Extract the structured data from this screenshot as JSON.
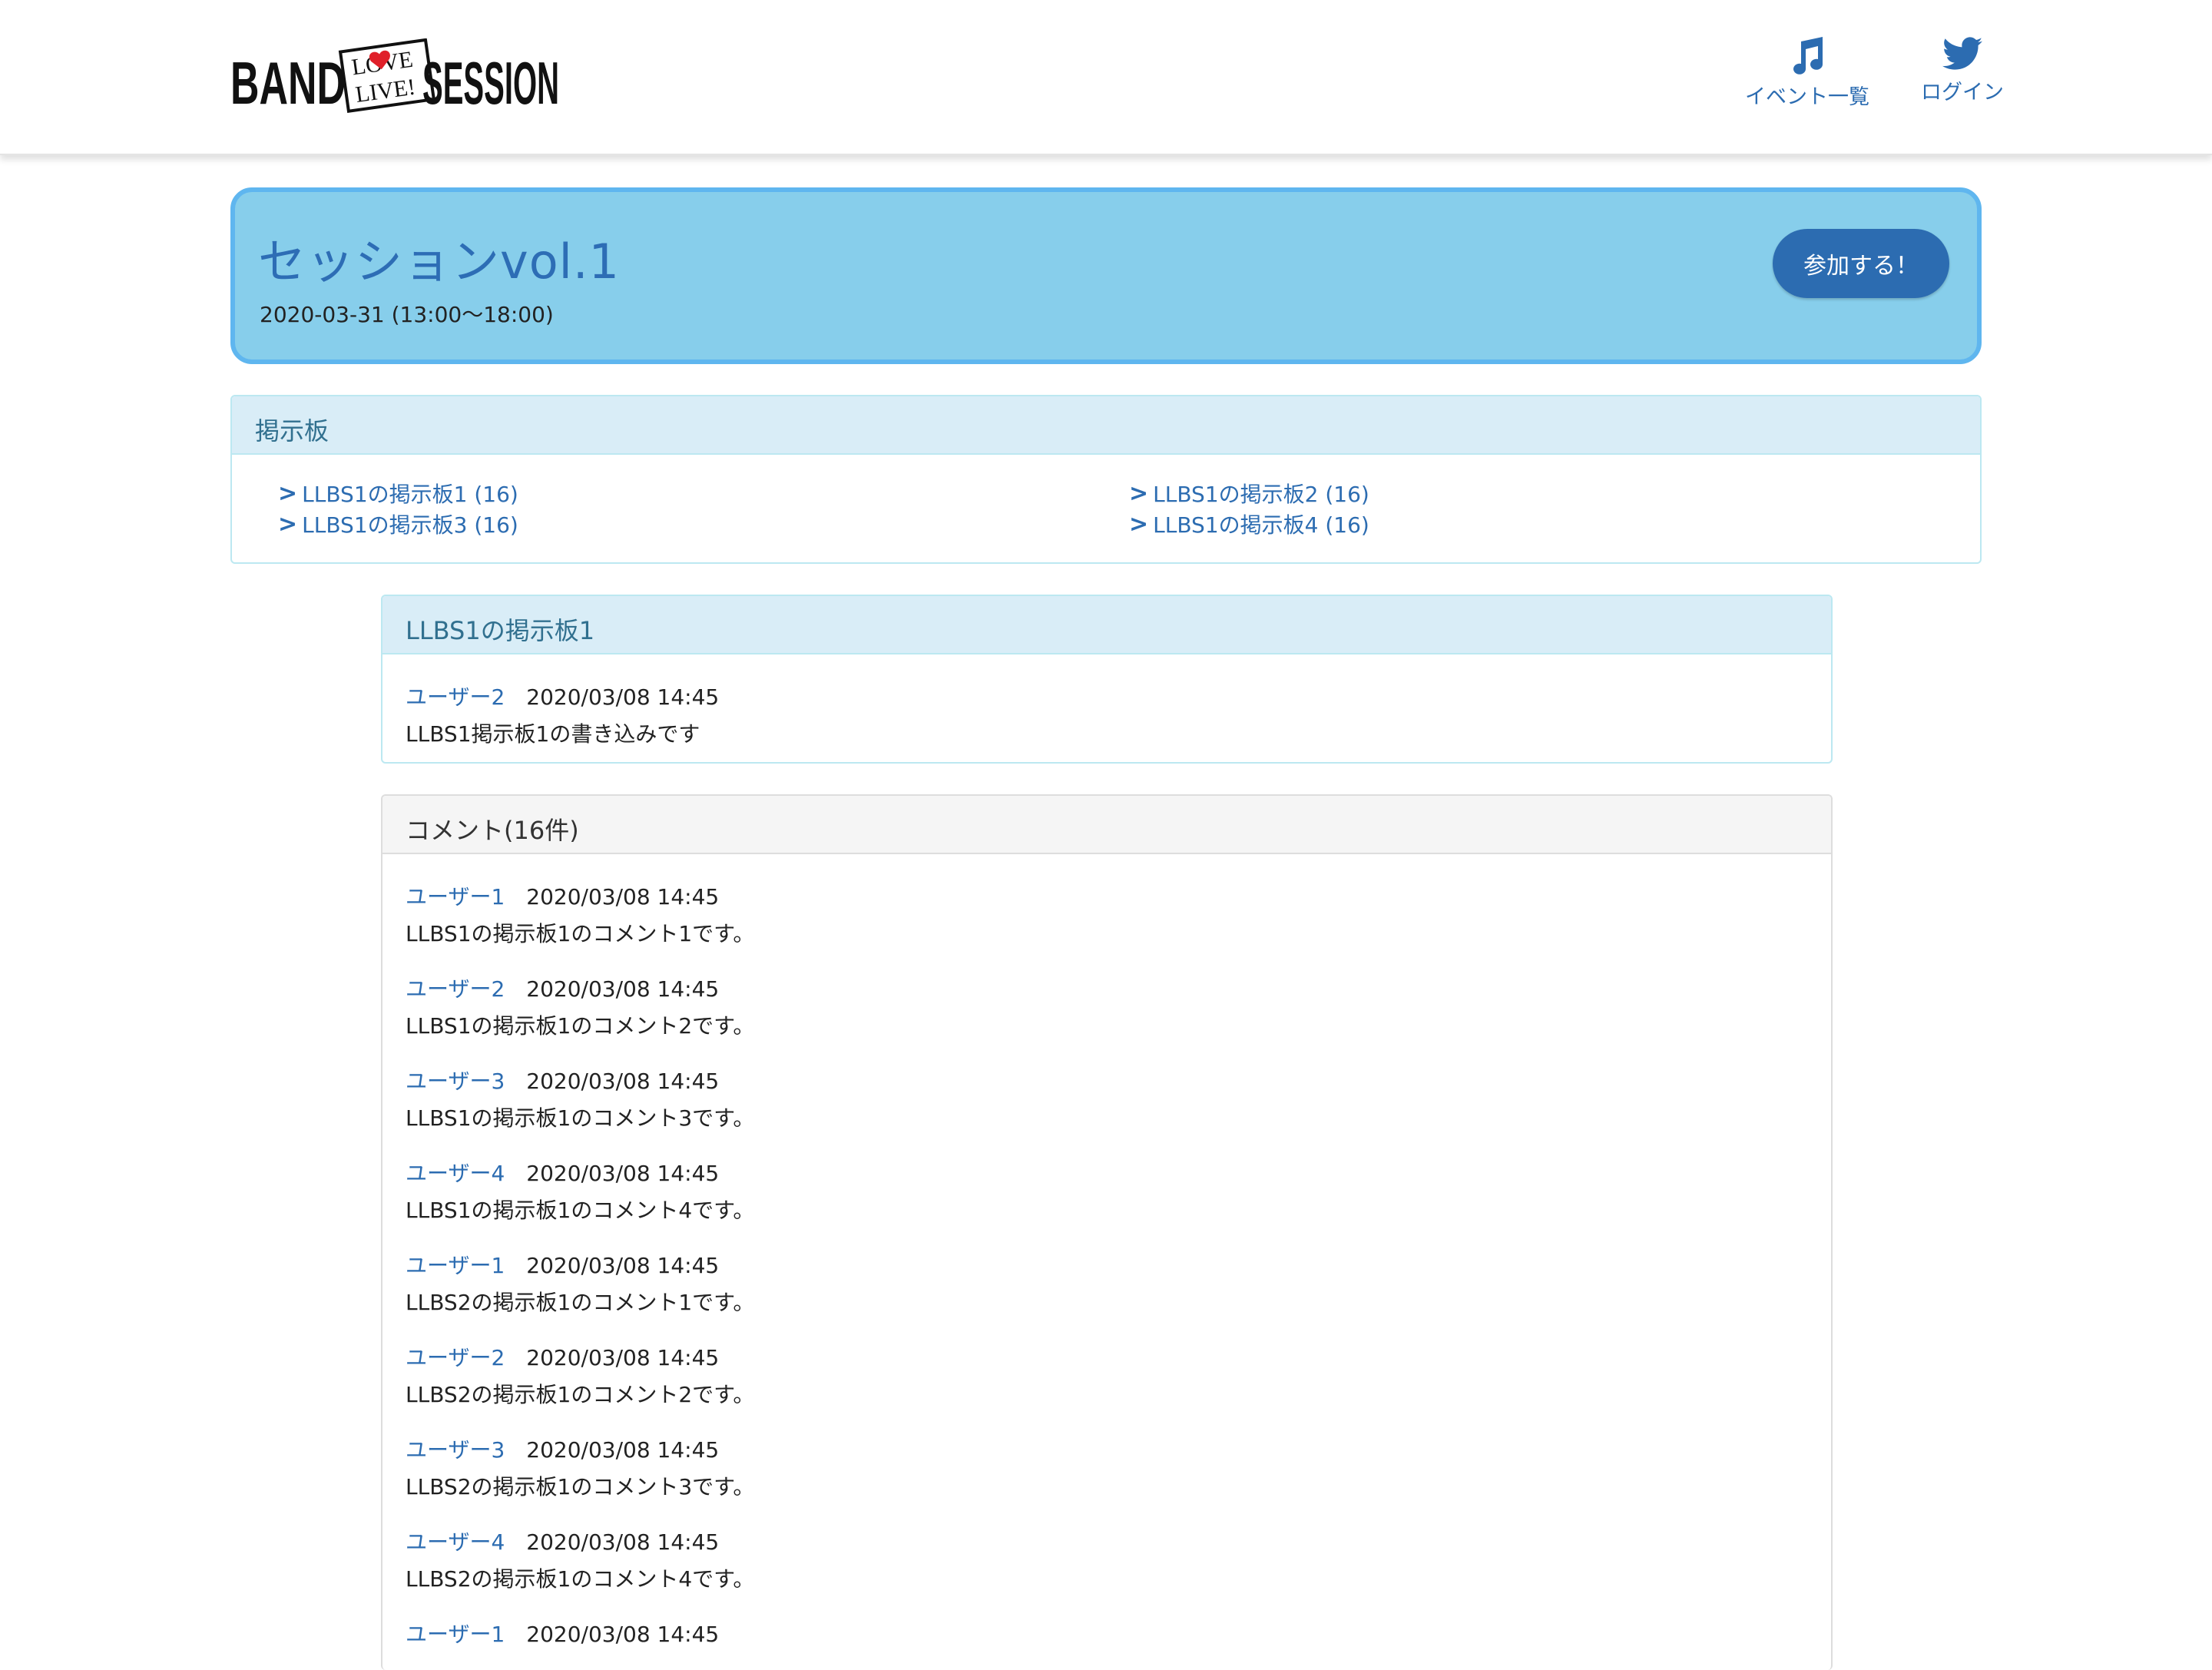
{
  "header": {
    "logo_text": "BAND LOVE LIVE! SESSION",
    "nav": [
      {
        "label": "イベント一覧",
        "icon": "music-note-icon"
      },
      {
        "label": "ログイン",
        "icon": "twitter-icon"
      }
    ]
  },
  "event": {
    "title": "セッションvol.1",
    "date": "2020-03-31 (13:00〜18:00)",
    "join_label": "参加する！"
  },
  "boards": {
    "heading": "掲示板",
    "links": [
      {
        "label": "LLBS1の掲示板1 (16)"
      },
      {
        "label": "LLBS1の掲示板2 (16)"
      },
      {
        "label": "LLBS1の掲示板3 (16)"
      },
      {
        "label": "LLBS1の掲示板4 (16)"
      }
    ]
  },
  "post": {
    "heading": "LLBS1の掲示板1",
    "user": "ユーザー2",
    "time": "2020/03/08 14:45",
    "body": "LLBS1掲示板1の書き込みです"
  },
  "comments": {
    "heading": "コメント(16件)",
    "items": [
      {
        "user": "ユーザー1",
        "time": "2020/03/08 14:45",
        "body": "LLBS1の掲示板1のコメント1です。"
      },
      {
        "user": "ユーザー2",
        "time": "2020/03/08 14:45",
        "body": "LLBS1の掲示板1のコメント2です。"
      },
      {
        "user": "ユーザー3",
        "time": "2020/03/08 14:45",
        "body": "LLBS1の掲示板1のコメント3です。"
      },
      {
        "user": "ユーザー4",
        "time": "2020/03/08 14:45",
        "body": "LLBS1の掲示板1のコメント4です。"
      },
      {
        "user": "ユーザー1",
        "time": "2020/03/08 14:45",
        "body": "LLBS2の掲示板1のコメント1です。"
      },
      {
        "user": "ユーザー2",
        "time": "2020/03/08 14:45",
        "body": "LLBS2の掲示板1のコメント2です。"
      },
      {
        "user": "ユーザー3",
        "time": "2020/03/08 14:45",
        "body": "LLBS2の掲示板1のコメント3です。"
      },
      {
        "user": "ユーザー4",
        "time": "2020/03/08 14:45",
        "body": "LLBS2の掲示板1のコメント4です。"
      },
      {
        "user": "ユーザー1",
        "time": "2020/03/08 14:45",
        "body": ""
      }
    ]
  }
}
